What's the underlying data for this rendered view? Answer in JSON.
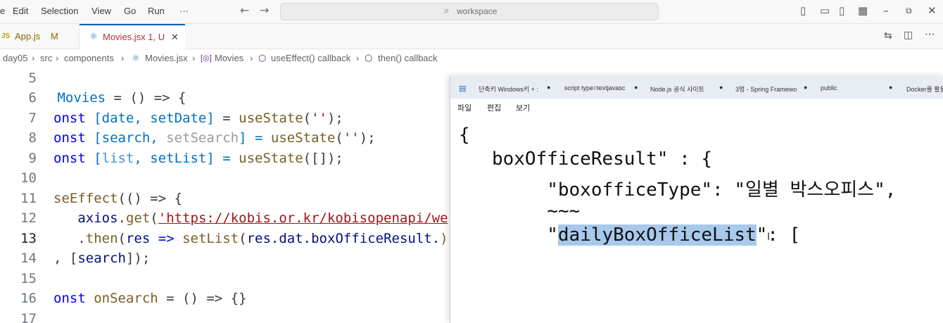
{
  "titlebar": {
    "menu": [
      "e",
      "Edit",
      "Selection",
      "View",
      "Go",
      "Run",
      "···"
    ],
    "search_placeholder": "workspace"
  },
  "tabs": [
    {
      "icon": "JS",
      "label": "App.js",
      "badge": "M"
    },
    {
      "icon": "⚛",
      "label": "Movies.jsx 1, U",
      "close": "✕"
    }
  ],
  "breadcrumb": [
    "day05",
    "src",
    "components",
    "Movies.jsx",
    "Movies",
    "useEffect() callback",
    "then() callback"
  ],
  "editor": {
    "line_numbers": [
      "5",
      "6",
      "7",
      "8",
      "9",
      "10",
      "11",
      "12",
      "13",
      "14",
      "15",
      "16",
      "17"
    ],
    "line6": {
      "a": " Movies",
      "b": " = () => {"
    },
    "line7": {
      "a": "onst ",
      "b": "[date, setDate]",
      "c": " = ",
      "d": "useState",
      "e": "(",
      "f": "''",
      "g": ");"
    },
    "line8": {
      "a": "onst ",
      "b": "[search, ",
      "c": "setSearch",
      "d": "] = ",
      "e": "useState",
      "f": "(",
      "g": "''",
      "h": ");"
    },
    "line9": {
      "a": "onst ",
      "b": "[",
      "c": "list",
      "d": ", setList] = ",
      "e": "useState",
      "f": "([]);"
    },
    "line11": {
      "a": "seEffect",
      "b": "(() => {"
    },
    "line12": {
      "a": "   axios",
      "b": ".",
      "c": "get",
      "d": "(",
      "e": "'https://kobis.or.kr/kobisopenapi/we"
    },
    "line13": {
      "a": "   .",
      "b": "then",
      "c": "(",
      "d": "res",
      "e": " => ",
      "f": "setList",
      "g": "(",
      "h": "res.dat.boxOfficeResult.",
      "i": ")"
    },
    "line14": {
      "a": ", [",
      "b": "search",
      "c": "]);"
    },
    "line16": {
      "a": "onst ",
      "b": "onSearch",
      "c": " = () => {}"
    }
  },
  "notepad": {
    "tabs": [
      "단축키 Windows키 + :",
      "script type=textjavasc",
      "Node.js 공식 사이트",
      "3멍 - Spring Framewo",
      "public",
      "Docker를 활용"
    ],
    "menu": [
      "파일",
      "편집",
      "보기"
    ],
    "lines": {
      "l1": "{",
      "l2": "   boxOfficeResult\" : {",
      "l3": "        \"boxofficeType\": \"일별 박스오피스\",",
      "l4": "        ~~~",
      "l5a": "        \"",
      "l5b": "dailyBoxOfficeList",
      "l5c": "\": ["
    }
  }
}
